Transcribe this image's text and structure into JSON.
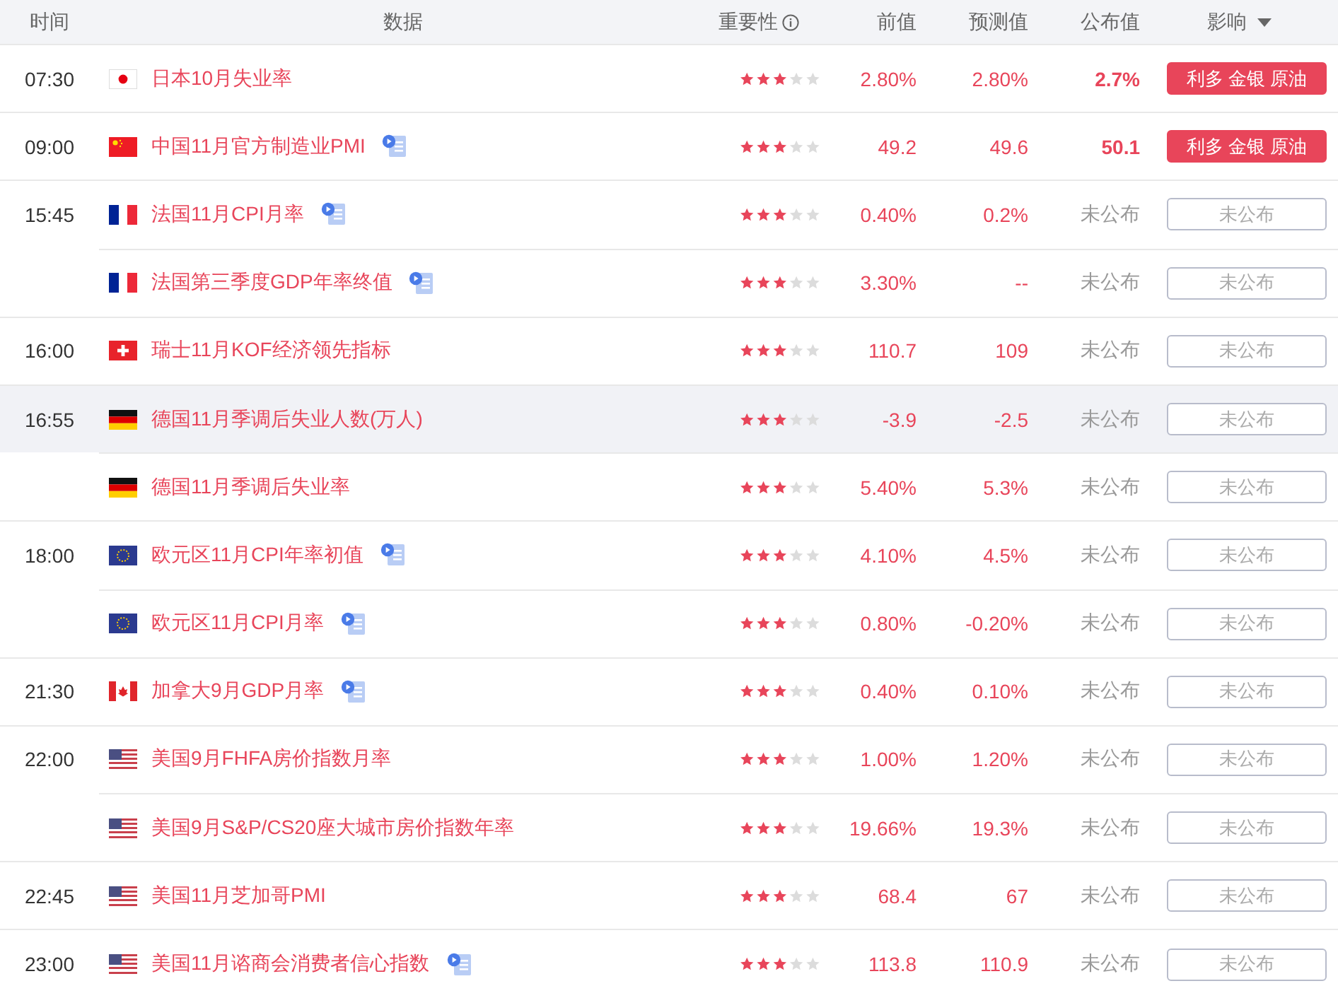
{
  "columns": [
    {
      "label": "时间"
    },
    {
      "label": "数据"
    },
    {
      "label": "重要性",
      "kind": "info"
    },
    {
      "label": "前值"
    },
    {
      "label": "预测值"
    },
    {
      "label": "公布值"
    },
    {
      "label": "影响",
      "kind": "sort"
    }
  ],
  "rows": [
    {
      "time": "07:30",
      "kind": "jp",
      "name": "日本10月失业率",
      "video": false,
      "stars": 3,
      "previous": "2.80%",
      "forecast": "2.80%",
      "actual": "2.7%",
      "released": true,
      "impact": {
        "kind": "bullish",
        "text": "利多 金银 原油"
      },
      "highlighted": false
    },
    {
      "time": "09:00",
      "kind": "cn",
      "name": "中国11月官方制造业PMI",
      "video": true,
      "stars": 3,
      "previous": "49.2",
      "forecast": "49.6",
      "actual": "50.1",
      "released": true,
      "impact": {
        "kind": "bullish",
        "text": "利多 金银 原油"
      },
      "highlighted": false
    },
    {
      "time": "15:45",
      "kind": "fr",
      "name": "法国11月CPI月率",
      "video": true,
      "stars": 3,
      "previous": "0.40%",
      "forecast": "0.2%",
      "actual": "未公布",
      "released": false,
      "impact": {
        "kind": "pending",
        "text": "未公布"
      },
      "highlighted": false
    },
    {
      "kind": "fr",
      "name": "法国第三季度GDP年率终值",
      "video": true,
      "stars": 3,
      "previous": "3.30%",
      "forecast": "--",
      "actual": "未公布",
      "released": false,
      "impact": {
        "kind": "pending",
        "text": "未公布"
      },
      "highlighted": false
    },
    {
      "time": "16:00",
      "kind": "ch",
      "name": "瑞士11月KOF经济领先指标",
      "video": false,
      "stars": 3,
      "previous": "110.7",
      "forecast": "109",
      "actual": "未公布",
      "released": false,
      "impact": {
        "kind": "pending",
        "text": "未公布"
      },
      "highlighted": false
    },
    {
      "time": "16:55",
      "kind": "de",
      "name": "德国11月季调后失业人数(万人)",
      "video": false,
      "stars": 3,
      "previous": "-3.9",
      "forecast": "-2.5",
      "actual": "未公布",
      "released": false,
      "impact": {
        "kind": "pending",
        "text": "未公布"
      },
      "highlighted": true
    },
    {
      "kind": "de",
      "name": "德国11月季调后失业率",
      "video": false,
      "stars": 3,
      "previous": "5.40%",
      "forecast": "5.3%",
      "actual": "未公布",
      "released": false,
      "impact": {
        "kind": "pending",
        "text": "未公布"
      },
      "highlighted": false
    },
    {
      "time": "18:00",
      "kind": "eu",
      "name": "欧元区11月CPI年率初值",
      "video": true,
      "stars": 3,
      "previous": "4.10%",
      "forecast": "4.5%",
      "actual": "未公布",
      "released": false,
      "impact": {
        "kind": "pending",
        "text": "未公布"
      },
      "highlighted": false
    },
    {
      "kind": "eu",
      "name": "欧元区11月CPI月率",
      "video": true,
      "stars": 3,
      "previous": "0.80%",
      "forecast": "-0.20%",
      "actual": "未公布",
      "released": false,
      "impact": {
        "kind": "pending",
        "text": "未公布"
      },
      "highlighted": false
    },
    {
      "time": "21:30",
      "kind": "ca",
      "name": "加拿大9月GDP月率",
      "video": true,
      "stars": 3,
      "previous": "0.40%",
      "forecast": "0.10%",
      "actual": "未公布",
      "released": false,
      "impact": {
        "kind": "pending",
        "text": "未公布"
      },
      "highlighted": false
    },
    {
      "time": "22:00",
      "kind": "us",
      "name": "美国9月FHFA房价指数月率",
      "video": false,
      "stars": 3,
      "previous": "1.00%",
      "forecast": "1.20%",
      "actual": "未公布",
      "released": false,
      "impact": {
        "kind": "pending",
        "text": "未公布"
      },
      "highlighted": false
    },
    {
      "kind": "us",
      "name": "美国9月S&P/CS20座大城市房价指数年率",
      "video": false,
      "stars": 3,
      "previous": "19.66%",
      "forecast": "19.3%",
      "actual": "未公布",
      "released": false,
      "impact": {
        "kind": "pending",
        "text": "未公布"
      },
      "highlighted": false
    },
    {
      "time": "22:45",
      "kind": "us",
      "name": "美国11月芝加哥PMI",
      "video": false,
      "stars": 3,
      "previous": "68.4",
      "forecast": "67",
      "actual": "未公布",
      "released": false,
      "impact": {
        "kind": "pending",
        "text": "未公布"
      },
      "highlighted": false
    },
    {
      "time": "23:00",
      "kind": "us",
      "name": "美国11月谘商会消费者信心指数",
      "video": true,
      "stars": 3,
      "previous": "113.8",
      "forecast": "110.9",
      "actual": "未公布",
      "released": false,
      "impact": {
        "kind": "pending",
        "text": "未公布"
      },
      "highlighted": false
    }
  ]
}
